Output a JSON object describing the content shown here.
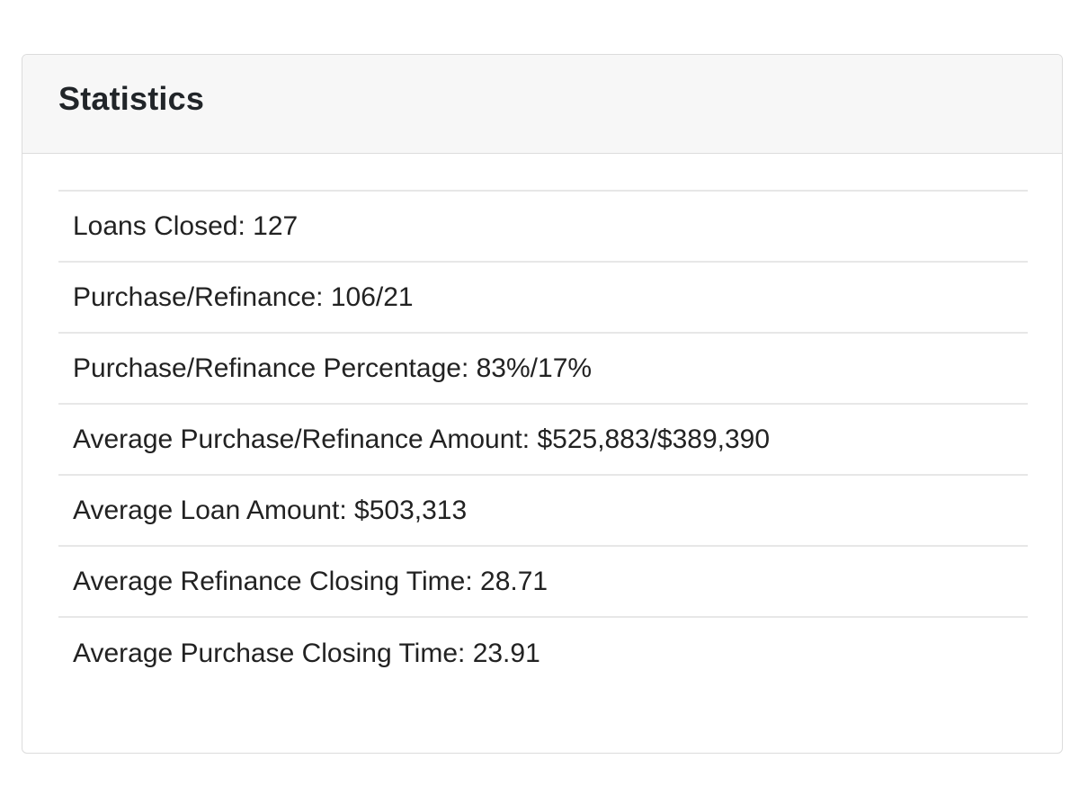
{
  "card": {
    "title": "Statistics"
  },
  "stats": [
    {
      "label": "Loans Closed:",
      "value": "127"
    },
    {
      "label": "Purchase/Refinance:",
      "value": "106/21"
    },
    {
      "label": "Purchase/Refinance Percentage:",
      "value": "83%/17%"
    },
    {
      "label": "Average Purchase/Refinance Amount:",
      "value": "$525,883/$389,390"
    },
    {
      "label": "Average Loan Amount:",
      "value": "$503,313"
    },
    {
      "label": "Average Refinance Closing Time:",
      "value": "28.71"
    },
    {
      "label": "Average Purchase Closing Time:",
      "value": "23.91"
    }
  ]
}
